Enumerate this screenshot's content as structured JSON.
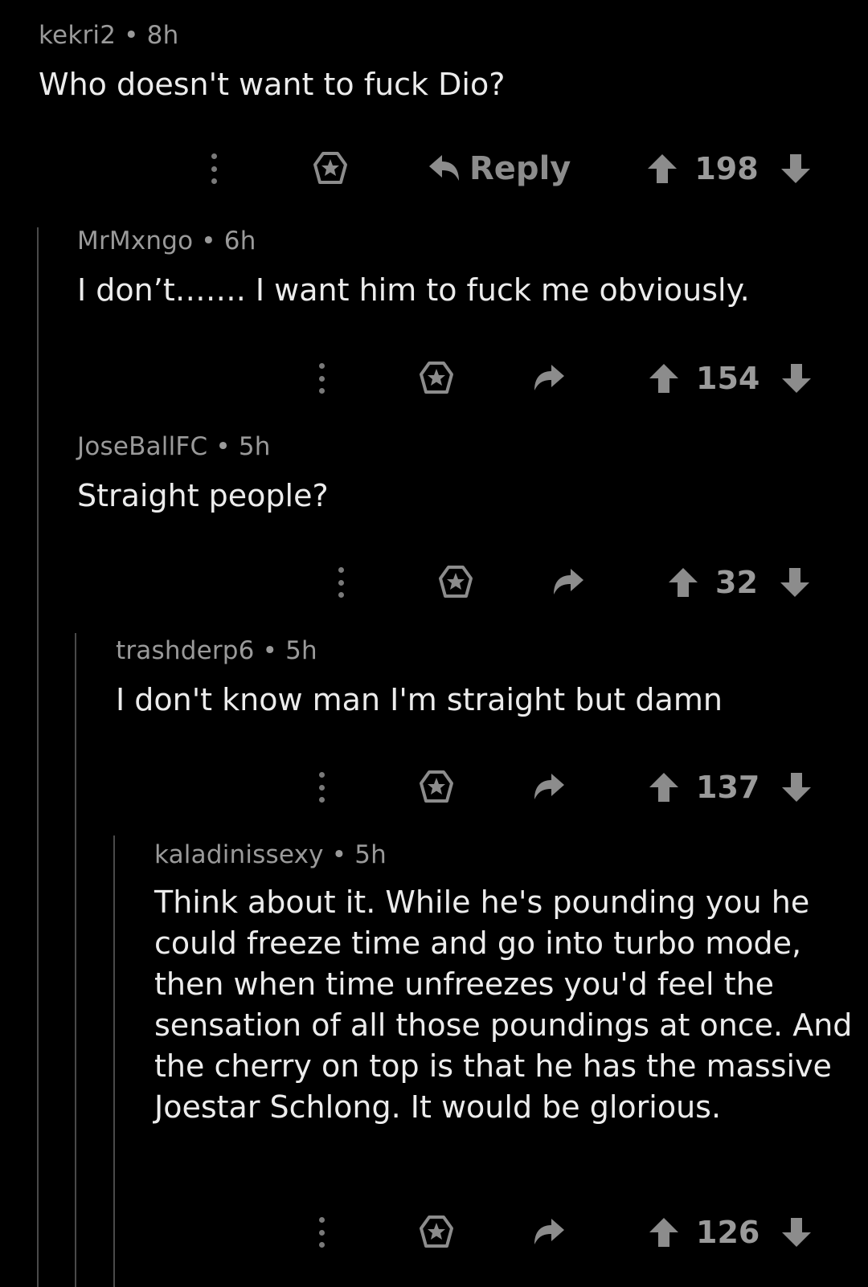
{
  "comments": [
    {
      "user": "kekri2",
      "sep": "•",
      "age": "8h",
      "text": "Who doesn't want to fuck Dio?",
      "reply_label": "Reply",
      "score": "198"
    },
    {
      "user": "MrMxngo",
      "sep": "•",
      "age": "6h",
      "text": "I don’t……. I want him to fuck me obviously.",
      "score": "154"
    },
    {
      "user": "JoseBallFC",
      "sep": "•",
      "age": "5h",
      "text": "Straight people?",
      "score": "32"
    },
    {
      "user": "trashderp6",
      "sep": "•",
      "age": "5h",
      "text": "I don't know man I'm straight but damn",
      "score": "137"
    },
    {
      "user": "kaladinissexy",
      "sep": "•",
      "age": "5h",
      "text": "Think about it. While he's pounding you he could freeze time and go into turbo mode, then when time unfreezes you'd feel the sensation of all those poundings at once. And the cherry on top is that he has the massive Joestar Schlong. It would be glorious.",
      "score": "126"
    }
  ],
  "colors": {
    "background": "#000000",
    "text": "#ececec",
    "meta": "#9a9a9a",
    "icon": "#8c8c8c",
    "thread_line": "#4a4a4a"
  },
  "icons": [
    "more-vertical-icon",
    "award-star-icon",
    "reply-arrow-icon",
    "upvote-arrow-icon",
    "downvote-arrow-icon"
  ]
}
